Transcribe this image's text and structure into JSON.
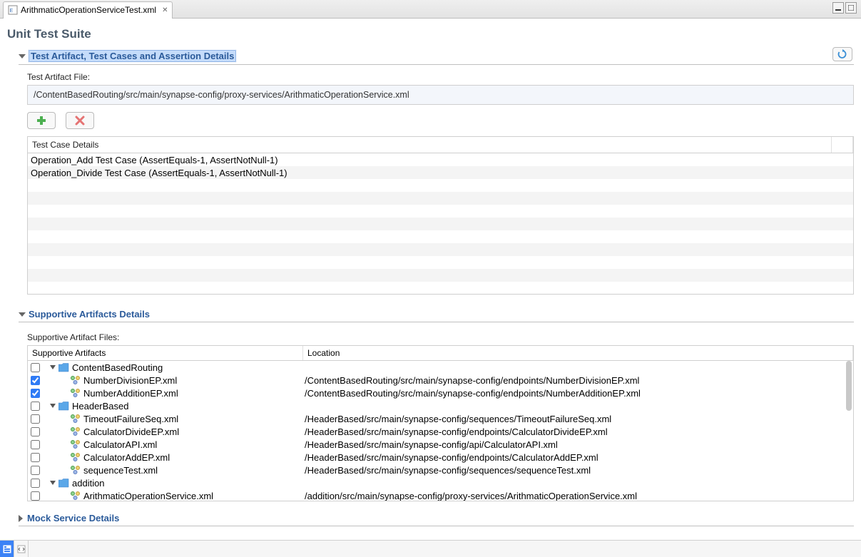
{
  "tab": {
    "title": "ArithmaticOperationServiceTest.xml"
  },
  "page": {
    "title": "Unit Test Suite"
  },
  "section1": {
    "title": "Test Artifact, Test Cases and Assertion Details",
    "fileLabel": "Test Artifact File:",
    "filePath": "/ContentBasedRouting/src/main/synapse-config/proxy-services/ArithmaticOperationService.xml",
    "tableHeader": "Test Case Details",
    "rows": [
      "Operation_Add Test Case (AssertEquals-1, AssertNotNull-1)",
      "Operation_Divide Test Case (AssertEquals-1, AssertNotNull-1)"
    ]
  },
  "section2": {
    "title": "Supportive Artifacts Details",
    "filesLabel": "Supportive Artifact Files:",
    "col1": "Supportive Artifacts",
    "col2": "Location",
    "tree": [
      {
        "type": "folder",
        "level": 0,
        "checked": false,
        "name": "ContentBasedRouting",
        "location": ""
      },
      {
        "type": "file",
        "level": 1,
        "checked": true,
        "name": "NumberDivisionEP.xml",
        "location": "/ContentBasedRouting/src/main/synapse-config/endpoints/NumberDivisionEP.xml"
      },
      {
        "type": "file",
        "level": 1,
        "checked": true,
        "name": "NumberAdditionEP.xml",
        "location": "/ContentBasedRouting/src/main/synapse-config/endpoints/NumberAdditionEP.xml"
      },
      {
        "type": "folder",
        "level": 0,
        "checked": false,
        "name": "HeaderBased",
        "location": ""
      },
      {
        "type": "file",
        "level": 1,
        "checked": false,
        "name": "TimeoutFailureSeq.xml",
        "location": "/HeaderBased/src/main/synapse-config/sequences/TimeoutFailureSeq.xml"
      },
      {
        "type": "file",
        "level": 1,
        "checked": false,
        "name": "CalculatorDivideEP.xml",
        "location": "/HeaderBased/src/main/synapse-config/endpoints/CalculatorDivideEP.xml"
      },
      {
        "type": "file",
        "level": 1,
        "checked": false,
        "name": "CalculatorAPI.xml",
        "location": "/HeaderBased/src/main/synapse-config/api/CalculatorAPI.xml"
      },
      {
        "type": "file",
        "level": 1,
        "checked": false,
        "name": "CalculatorAddEP.xml",
        "location": "/HeaderBased/src/main/synapse-config/endpoints/CalculatorAddEP.xml"
      },
      {
        "type": "file",
        "level": 1,
        "checked": false,
        "name": "sequenceTest.xml",
        "location": "/HeaderBased/src/main/synapse-config/sequences/sequenceTest.xml"
      },
      {
        "type": "folder",
        "level": 0,
        "checked": false,
        "name": "addition",
        "location": ""
      },
      {
        "type": "file",
        "level": 1,
        "checked": false,
        "name": "ArithmaticOperationService.xml",
        "location": "/addition/src/main/synapse-config/proxy-services/ArithmaticOperationService.xml"
      }
    ]
  },
  "section3": {
    "title": "Mock Service Details"
  }
}
